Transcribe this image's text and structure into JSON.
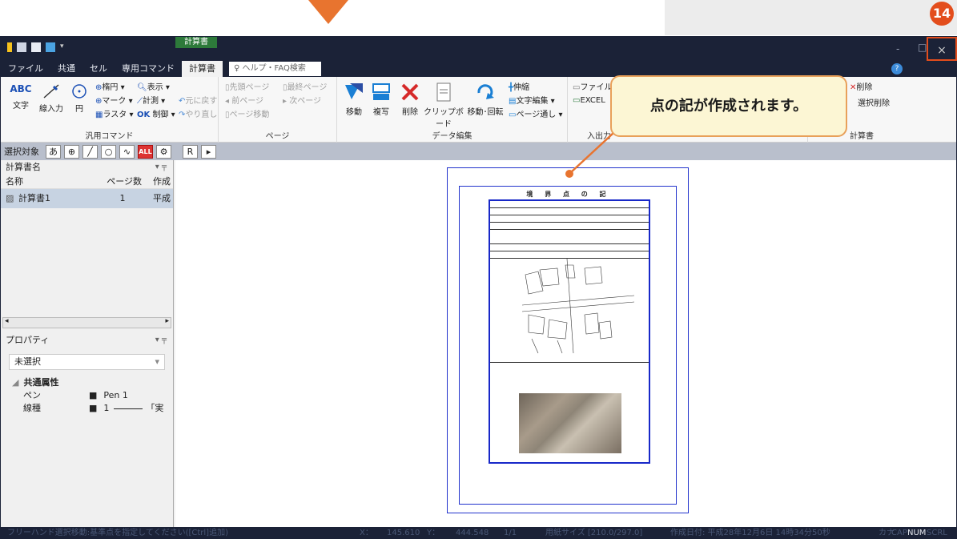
{
  "titlebar": {
    "context_tab_group": "計算書",
    "min_symbol": "-",
    "max_symbol": "□",
    "close_symbol": "×"
  },
  "tabs": [
    {
      "label": "ファイル"
    },
    {
      "label": "共通"
    },
    {
      "label": "セル"
    },
    {
      "label": "専用コマンド"
    },
    {
      "label": "計算書"
    }
  ],
  "help_search": {
    "placeholder": "ヘルプ・FAQ検索",
    "icon": "lightbulb-icon"
  },
  "help_button": "?",
  "ribbon": {
    "general": {
      "label": "汎用コマンド",
      "abc": "ABC",
      "text": "文字",
      "line": "線入力",
      "circle": "円",
      "ellipse": "楕円",
      "display": "表示",
      "mark": "マーク",
      "measure": "計測",
      "undo": "元に戻す",
      "raster": "ラスタ",
      "ok": "OK",
      "control": "制御",
      "redo": "やり直し"
    },
    "page": {
      "label": "ページ",
      "first": "先頭ページ",
      "last": "最終ページ",
      "prev": "前ページ",
      "next": "次ページ",
      "move": "ページ移動"
    },
    "edit": {
      "label": "データ編集",
      "move": "移動",
      "copy": "複写",
      "delete": "削除",
      "clipboard": "クリップボード",
      "move_rotate": "移動･回転",
      "stretch": "伸縮",
      "text_edit": "文字編集",
      "page_through": "ページ通し"
    },
    "io": {
      "label": "入出力",
      "file_out": "ファイル出",
      "excel": "EXCEL"
    },
    "calc": {
      "label": "計算書",
      "delete": "削除",
      "delete_selected": "選択削除"
    }
  },
  "selectbar": {
    "label": "選択対象",
    "tools": [
      "あ",
      "⊕",
      "╱",
      "○",
      "∿",
      "ALL",
      "⚙",
      "R",
      "▸"
    ]
  },
  "calc_panel": {
    "title": "計算書名",
    "col_name": "名称",
    "col_pages": "ページ数",
    "col_created": "作成",
    "rows": [
      {
        "name": "計算書1",
        "pages": "1",
        "created": "平成"
      }
    ]
  },
  "property_panel": {
    "title": "プロパティ",
    "select_value": "未選択",
    "section": "共通属性",
    "pen_label": "ペン",
    "pen_value": "Pen 1",
    "linetype_label": "線種",
    "linetype_value": "1",
    "linetype_name": "「実"
  },
  "sheet": {
    "title": "境 界 点 の 記"
  },
  "callout": {
    "text": "点の記が作成されます。"
  },
  "badge": "14",
  "status": {
    "message": "フリーハンド選択移動:基準点を指定してください([Ctrl]追加)",
    "x_label": "X：",
    "x_value": "145.610",
    "y_label": "Y：",
    "y_value": "444.548",
    "page": "1/1",
    "paper": "用紙サイズ [210.0/297.0]",
    "created": "作成日付: 平成28年12月6日 14時34分50秒",
    "kana": "カナ",
    "cap": "CAP",
    "num": "NUM",
    "scrl": "SCRL"
  }
}
